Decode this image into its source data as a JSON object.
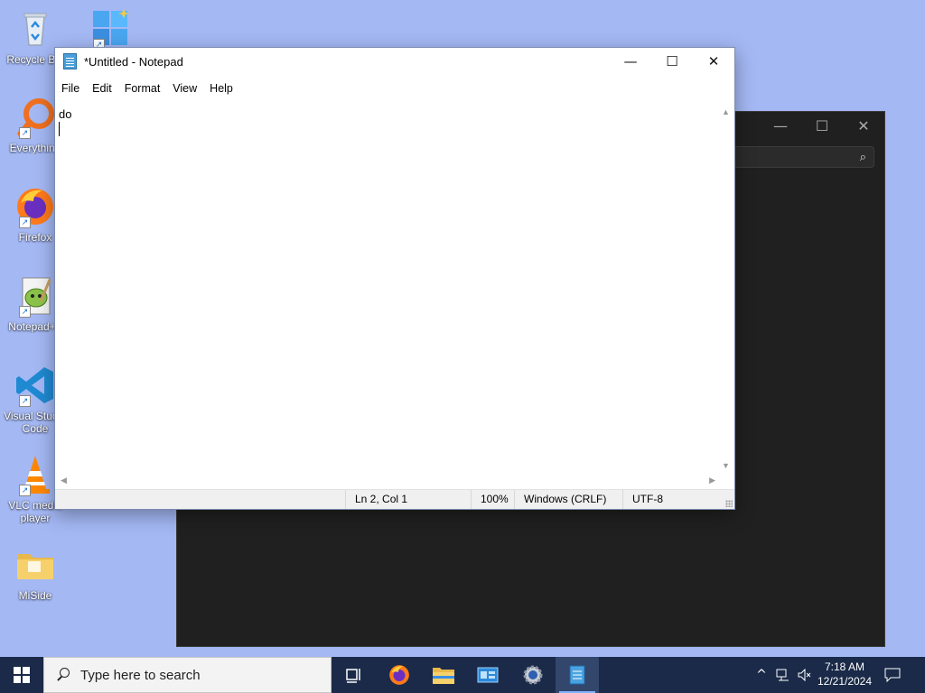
{
  "desktop": {
    "icons": [
      {
        "label": "Recycle Bin",
        "icon": "recycle-bin-icon"
      },
      {
        "label": "Everything",
        "icon": "everything-search-icon"
      },
      {
        "label": "Firefox",
        "icon": "firefox-icon"
      },
      {
        "label": "Notepad++",
        "icon": "notepad-plus-plus-icon"
      },
      {
        "label": "Visual Studio Code",
        "icon": "vscode-icon"
      },
      {
        "label": "VLC media player",
        "icon": "vlc-icon"
      },
      {
        "label": "MiSide",
        "icon": "folder-icon"
      }
    ],
    "background_color": "#a4b8f4"
  },
  "background_window": {
    "controls": {
      "minimize": "—",
      "maximize": "☐",
      "close": "✕"
    },
    "search_icon": "⌕"
  },
  "notepad": {
    "title": "*Untitled - Notepad",
    "controls": {
      "minimize": "—",
      "maximize": "☐",
      "close": "✕"
    },
    "menu": [
      "File",
      "Edit",
      "Format",
      "View",
      "Help"
    ],
    "content": {
      "line1": "do",
      "line2": ""
    },
    "status": {
      "position": "Ln 2, Col 1",
      "zoom": "100%",
      "line_ending": "Windows (CRLF)",
      "encoding": "UTF-8"
    }
  },
  "taskbar": {
    "search_placeholder": "Type here to search",
    "apps": [
      "task-view-icon",
      "firefox-icon",
      "file-explorer-icon",
      "control-panel-icon",
      "settings-icon",
      "notepad-icon"
    ],
    "tray": {
      "time": "7:18 AM",
      "date": "12/21/2024"
    },
    "color": "#1a2a48"
  }
}
